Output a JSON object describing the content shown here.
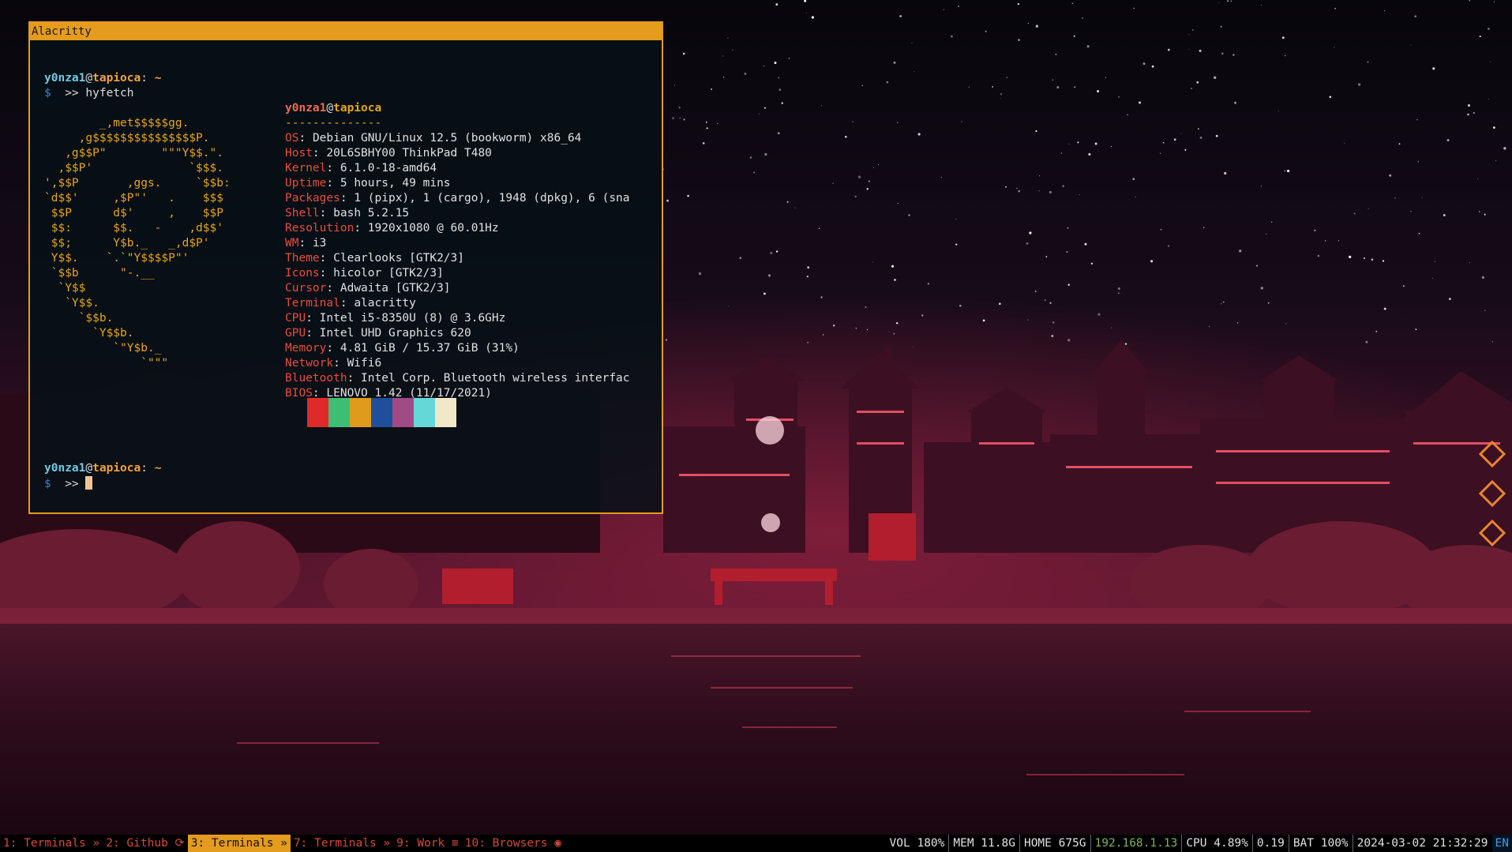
{
  "window": {
    "title": "Alacritty"
  },
  "prompt": {
    "user": "y0nza1",
    "at": "@",
    "host": "tapioca",
    "sep": ":",
    "dir": "~",
    "dollar": "$",
    "arrow": ">>",
    "command": "hyfetch"
  },
  "logo_lines": [
    "        _,met$$$$$gg.",
    "     ,g$$$$$$$$$$$$$$$P.",
    "   ,g$$P\"        \"\"\"Y$$.\".",
    "  ,$$P'              `$$$.",
    "',$$P       ,ggs.     `$$b:",
    "`d$$'     ,$P\"'   .    $$$",
    " $$P      d$'     ,    $$P",
    " $$:      $$.   -    ,d$$'",
    " $$;      Y$b._   _,d$P'",
    " Y$$.    `.`\"Y$$$$P\"'",
    " `$$b      \"-.__",
    "  `Y$$",
    "   `Y$$.",
    "     `$$b.",
    "       `Y$$b.",
    "          `\"Y$b._",
    "              `\"\"\""
  ],
  "info": {
    "user": "y0nza1",
    "at": "@",
    "host": "tapioca",
    "underline": "--------------",
    "rows": [
      {
        "key": "OS",
        "value": "Debian GNU/Linux 12.5 (bookworm) x86_64"
      },
      {
        "key": "Host",
        "value": "20L6SBHY00 ThinkPad T480"
      },
      {
        "key": "Kernel",
        "value": "6.1.0-18-amd64"
      },
      {
        "key": "Uptime",
        "value": "5 hours, 49 mins"
      },
      {
        "key": "Packages",
        "value": "1 (pipx), 1 (cargo), 1948 (dpkg), 6 (sna"
      },
      {
        "key": "Shell",
        "value": "bash 5.2.15"
      },
      {
        "key": "Resolution",
        "value": "1920x1080 @ 60.01Hz"
      },
      {
        "key": "WM",
        "value": "i3"
      },
      {
        "key": "Theme",
        "value": "Clearlooks [GTK2/3]"
      },
      {
        "key": "Icons",
        "value": "hicolor [GTK2/3]"
      },
      {
        "key": "Cursor",
        "value": "Adwaita [GTK2/3]"
      },
      {
        "key": "Terminal",
        "value": "alacritty"
      },
      {
        "key": "CPU",
        "value": "Intel i5-8350U (8) @ 3.6GHz"
      },
      {
        "key": "GPU",
        "value": "Intel UHD Graphics 620"
      },
      {
        "key": "Memory",
        "value": "4.81 GiB / 15.37 GiB (31%)"
      },
      {
        "key": "Network",
        "value": "Wifi6"
      },
      {
        "key": "Bluetooth",
        "value": "Intel Corp. Bluetooth wireless interfac"
      },
      {
        "key": "BIOS",
        "value": "LENOVO 1.42 (11/17/2021)"
      }
    ],
    "swatches": [
      "#e02a2a",
      "#3ebd74",
      "#e09a1c",
      "#1f4f9a",
      "#a04a86",
      "#62d9d6",
      "#f1e8c8"
    ]
  },
  "workspaces": [
    {
      "label": "1: Terminals",
      "sym": " »",
      "active": false
    },
    {
      "label": "2: Github",
      "sym": " ⟳",
      "active": false
    },
    {
      "label": "3: Terminals",
      "sym": " »",
      "active": true
    },
    {
      "label": "7: Terminals",
      "sym": " »",
      "active": false
    },
    {
      "label": "9: Work",
      "sym": " ≡",
      "active": false
    },
    {
      "label": "10: Browsers",
      "sym": " ◉",
      "active": false
    }
  ],
  "status": {
    "vol": "VOL 180%",
    "mem": "MEM 11.8G",
    "home": "HOME 675G",
    "ip": "192.168.1.13",
    "cpu": "CPU 4.89%",
    "load": "0.19",
    "bat": "BAT 100%",
    "datetime": "2024-03-02 21:32:29",
    "lang": "EN"
  },
  "colors": {
    "accent": "#e59b1e",
    "ws_text": "#d64a38",
    "ip": "#7fb35a",
    "lang": "#3ea0e5"
  }
}
